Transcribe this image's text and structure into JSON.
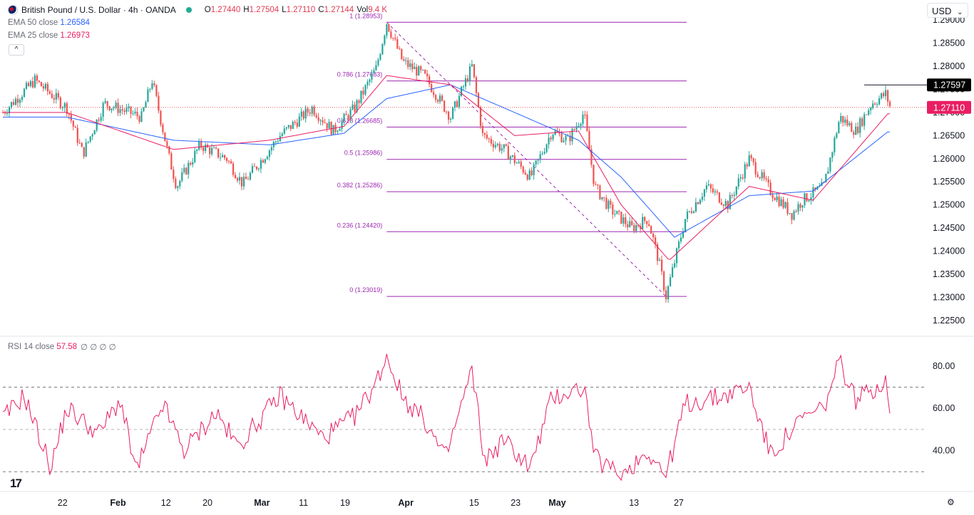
{
  "header": {
    "symbol_title": "British Pound / U.S. Dollar · 4h · OANDA",
    "ohlc": [
      {
        "k": "O",
        "v": "1.27440"
      },
      {
        "k": "H",
        "v": "1.27504"
      },
      {
        "k": "L",
        "v": "1.27110"
      },
      {
        "k": "C",
        "v": "1.27144"
      },
      {
        "k": "Vol",
        "v": "9.4 K"
      }
    ],
    "currency": "USD",
    "collapse": "^"
  },
  "indicators": {
    "ema50": {
      "label": "EMA 50 close",
      "value": "1.26584",
      "color": "#2962ff"
    },
    "ema25": {
      "label": "EMA 25 close",
      "value": "1.26973",
      "color": "#e91e63"
    },
    "rsi": {
      "label": "RSI 14 close",
      "value": "57.58",
      "extras": "∅ ∅ ∅ ∅",
      "color": "#e91e63"
    }
  },
  "colors": {
    "up": "#26a69a",
    "down": "#ef5350",
    "fib": "#9c27b0",
    "last_price_tag": "#e91e63",
    "hover_tag": "#000000"
  },
  "price_tags": {
    "hover": "1.27597",
    "last": "1.27110"
  },
  "chart_data": [
    {
      "type": "candlestick",
      "title": "British Pound / U.S. Dollar · 4h · OANDA",
      "y_ticks": [
        "1.29000",
        "1.28500",
        "1.28000",
        "1.27500",
        "1.27000",
        "1.26500",
        "1.26000",
        "1.25500",
        "1.25000",
        "1.24500",
        "1.24000",
        "1.23500",
        "1.23000",
        "1.22500"
      ],
      "ylim": [
        1.2225,
        1.2925
      ],
      "x_ticks": [
        "22",
        "Feb",
        "12",
        "20",
        "Mar",
        "11",
        "19",
        "Apr",
        "15",
        "23",
        "May",
        "13",
        "27"
      ],
      "key_points": [
        {
          "t": 0,
          "p": 1.27
        },
        {
          "t": 30,
          "p": 1.277
        },
        {
          "t": 60,
          "p": 1.271
        },
        {
          "t": 75,
          "p": 1.261
        },
        {
          "t": 95,
          "p": 1.272
        },
        {
          "t": 130,
          "p": 1.269
        },
        {
          "t": 140,
          "p": 1.277
        },
        {
          "t": 155,
          "p": 1.261
        },
        {
          "t": 163,
          "p": 1.254
        },
        {
          "t": 185,
          "p": 1.263
        },
        {
          "t": 210,
          "p": 1.26
        },
        {
          "t": 225,
          "p": 1.2545
        },
        {
          "t": 260,
          "p": 1.265
        },
        {
          "t": 290,
          "p": 1.271
        },
        {
          "t": 310,
          "p": 1.266
        },
        {
          "t": 330,
          "p": 1.271
        },
        {
          "t": 350,
          "p": 1.2795
        },
        {
          "t": 360,
          "p": 1.2895
        },
        {
          "t": 375,
          "p": 1.281
        },
        {
          "t": 395,
          "p": 1.278
        },
        {
          "t": 420,
          "p": 1.269
        },
        {
          "t": 440,
          "p": 1.28
        },
        {
          "t": 450,
          "p": 1.265
        },
        {
          "t": 470,
          "p": 1.262
        },
        {
          "t": 495,
          "p": 1.256
        },
        {
          "t": 515,
          "p": 1.266
        },
        {
          "t": 530,
          "p": 1.264
        },
        {
          "t": 545,
          "p": 1.27
        },
        {
          "t": 555,
          "p": 1.254
        },
        {
          "t": 570,
          "p": 1.249
        },
        {
          "t": 590,
          "p": 1.245
        },
        {
          "t": 605,
          "p": 1.247
        },
        {
          "t": 615,
          "p": 1.238
        },
        {
          "t": 622,
          "p": 1.2302
        },
        {
          "t": 640,
          "p": 1.247
        },
        {
          "t": 660,
          "p": 1.254
        },
        {
          "t": 680,
          "p": 1.25
        },
        {
          "t": 700,
          "p": 1.26
        },
        {
          "t": 720,
          "p": 1.253
        },
        {
          "t": 740,
          "p": 1.248
        },
        {
          "t": 750,
          "p": 1.251
        },
        {
          "t": 770,
          "p": 1.254
        },
        {
          "t": 785,
          "p": 1.269
        },
        {
          "t": 800,
          "p": 1.266
        },
        {
          "t": 815,
          "p": 1.272
        },
        {
          "t": 828,
          "p": 1.274
        },
        {
          "t": 832,
          "p": 1.2714
        }
      ],
      "ema50": [
        {
          "t": 0,
          "p": 1.269
        },
        {
          "t": 60,
          "p": 1.269
        },
        {
          "t": 160,
          "p": 1.264
        },
        {
          "t": 250,
          "p": 1.263
        },
        {
          "t": 320,
          "p": 1.2655
        },
        {
          "t": 360,
          "p": 1.273
        },
        {
          "t": 420,
          "p": 1.276
        },
        {
          "t": 480,
          "p": 1.27
        },
        {
          "t": 540,
          "p": 1.264
        },
        {
          "t": 580,
          "p": 1.256
        },
        {
          "t": 630,
          "p": 1.243
        },
        {
          "t": 700,
          "p": 1.252
        },
        {
          "t": 760,
          "p": 1.253
        },
        {
          "t": 830,
          "p": 1.2658
        }
      ],
      "ema25": [
        {
          "t": 0,
          "p": 1.27
        },
        {
          "t": 60,
          "p": 1.27
        },
        {
          "t": 160,
          "p": 1.262
        },
        {
          "t": 250,
          "p": 1.264
        },
        {
          "t": 320,
          "p": 1.267
        },
        {
          "t": 360,
          "p": 1.278
        },
        {
          "t": 420,
          "p": 1.276
        },
        {
          "t": 480,
          "p": 1.265
        },
        {
          "t": 540,
          "p": 1.266
        },
        {
          "t": 580,
          "p": 1.25
        },
        {
          "t": 625,
          "p": 1.238
        },
        {
          "t": 700,
          "p": 1.254
        },
        {
          "t": 760,
          "p": 1.251
        },
        {
          "t": 830,
          "p": 1.2697
        }
      ],
      "fibonacci": [
        {
          "level": "1",
          "price": 1.28953,
          "label": "1 (1.28953)"
        },
        {
          "level": "0.786",
          "price": 1.27683,
          "label": "0.786 (1.27683)"
        },
        {
          "level": "0.618",
          "price": 1.26685,
          "label": "0.618 (1.26685)"
        },
        {
          "level": "0.5",
          "price": 1.25986,
          "label": "0.5 (1.25986)"
        },
        {
          "level": "0.382",
          "price": 1.25286,
          "label": "0.382 (1.25286)"
        },
        {
          "level": "0.236",
          "price": 1.2442,
          "label": "0.236 (1.24420)"
        },
        {
          "level": "0",
          "price": 1.23019,
          "label": "0 (1.23019)"
        }
      ],
      "fib_trend_from": {
        "t": 360,
        "p": 1.28953
      },
      "fib_trend_to": {
        "t": 622,
        "p": 1.23019
      },
      "reference_price": 1.2711,
      "hover_price": 1.27597
    },
    {
      "type": "line",
      "title": "RSI 14 close",
      "y_ticks": [
        "80.00",
        "60.00",
        "40.00"
      ],
      "ylim": [
        24,
        88
      ],
      "bands": [
        70,
        50,
        30
      ],
      "key_points": [
        {
          "t": 0,
          "p": 55
        },
        {
          "t": 20,
          "p": 66
        },
        {
          "t": 45,
          "p": 32
        },
        {
          "t": 60,
          "p": 60
        },
        {
          "t": 90,
          "p": 48
        },
        {
          "t": 110,
          "p": 64
        },
        {
          "t": 125,
          "p": 30
        },
        {
          "t": 150,
          "p": 62
        },
        {
          "t": 170,
          "p": 40
        },
        {
          "t": 200,
          "p": 58
        },
        {
          "t": 220,
          "p": 42
        },
        {
          "t": 260,
          "p": 66
        },
        {
          "t": 300,
          "p": 46
        },
        {
          "t": 330,
          "p": 56
        },
        {
          "t": 350,
          "p": 72
        },
        {
          "t": 360,
          "p": 85
        },
        {
          "t": 375,
          "p": 65
        },
        {
          "t": 395,
          "p": 55
        },
        {
          "t": 415,
          "p": 36
        },
        {
          "t": 440,
          "p": 78
        },
        {
          "t": 452,
          "p": 35
        },
        {
          "t": 470,
          "p": 45
        },
        {
          "t": 495,
          "p": 32
        },
        {
          "t": 515,
          "p": 65
        },
        {
          "t": 545,
          "p": 70
        },
        {
          "t": 556,
          "p": 36
        },
        {
          "t": 580,
          "p": 28
        },
        {
          "t": 605,
          "p": 40
        },
        {
          "t": 622,
          "p": 28
        },
        {
          "t": 640,
          "p": 62
        },
        {
          "t": 670,
          "p": 65
        },
        {
          "t": 700,
          "p": 70
        },
        {
          "t": 720,
          "p": 38
        },
        {
          "t": 750,
          "p": 55
        },
        {
          "t": 770,
          "p": 60
        },
        {
          "t": 785,
          "p": 82
        },
        {
          "t": 800,
          "p": 64
        },
        {
          "t": 828,
          "p": 73
        },
        {
          "t": 832,
          "p": 57.58
        }
      ]
    }
  ]
}
